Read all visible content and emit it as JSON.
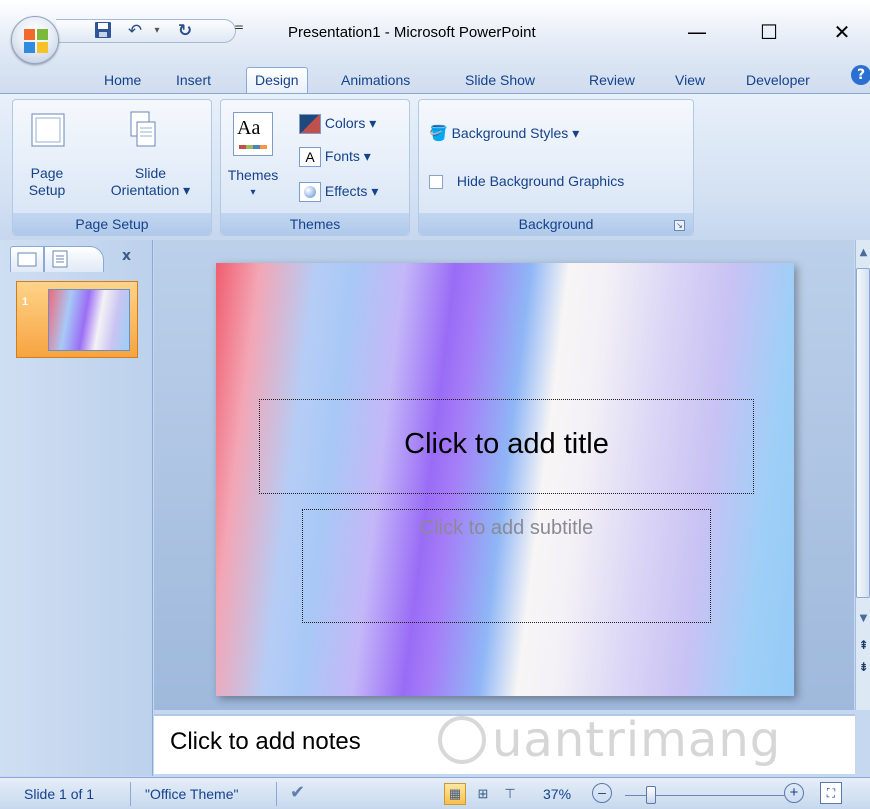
{
  "window": {
    "title": "Presentation1 - Microsoft PowerPoint",
    "minimize": "—",
    "maximize": "☐",
    "close": "✕"
  },
  "qat": {
    "save_icon": "floppy-disk-icon",
    "undo_icon": "undo-icon",
    "redo_icon": "redo-icon",
    "customize": "="
  },
  "tabs": [
    "Home",
    "Insert",
    "Design",
    "Animations",
    "Slide Show",
    "Review",
    "View",
    "Developer"
  ],
  "active_tab": "Design",
  "ribbon": {
    "page_setup_group": {
      "label": "Page Setup",
      "page_setup_line1": "Page",
      "page_setup_line2": "Setup",
      "orientation_line1": "Slide",
      "orientation_line2": "Orientation ▾"
    },
    "themes_group": {
      "label": "Themes",
      "themes_btn": "Themes",
      "themes_dropdown": "▾",
      "theme_icon_text": "Aa",
      "colors": "Colors ▾",
      "fonts": "Fonts ▾",
      "effects": "Effects ▾"
    },
    "background_group": {
      "label": "Background",
      "styles": "Background Styles ▾",
      "hide_graphics": "Hide Background Graphics"
    }
  },
  "slides_panel": {
    "close": "x",
    "slide_number": "1"
  },
  "slide": {
    "title_placeholder": "Click to add title",
    "subtitle_placeholder": "Click to add subtitle"
  },
  "notes": {
    "placeholder": "Click to add notes"
  },
  "watermark": "uantrimang",
  "status": {
    "slide_info": "Slide 1 of 1",
    "theme_name": "\"Office Theme\"",
    "zoom": "37%",
    "zoom_out": "–",
    "zoom_in": "+"
  }
}
